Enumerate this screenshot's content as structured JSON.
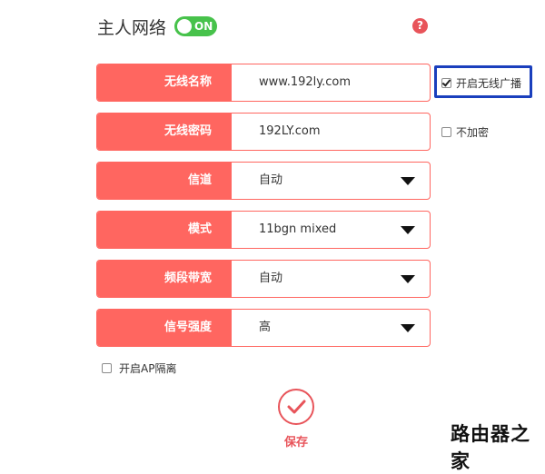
{
  "header": {
    "title": "主人网络",
    "toggle_label": "ON",
    "help_symbol": "?"
  },
  "form": {
    "rows": [
      {
        "label": "无线名称",
        "value": "www.192ly.com"
      },
      {
        "label": "无线密码",
        "value": "192LY.com"
      },
      {
        "label": "信道",
        "value": "自动"
      },
      {
        "label": "模式",
        "value": "11bgn mixed"
      },
      {
        "label": "频段带宽",
        "value": "自动"
      },
      {
        "label": "信号强度",
        "value": "高"
      }
    ],
    "broadcast_checkbox": {
      "label": "开启无线广播",
      "checked": true
    },
    "no_encrypt_checkbox": {
      "label": "不加密",
      "checked": false
    },
    "ap_isolation_checkbox": {
      "label": "开启AP隔离",
      "checked": false
    }
  },
  "footer": {
    "save_label": "保存"
  },
  "watermark": "路由器之家",
  "colors": {
    "accent": "#ff6660",
    "toggle_on": "#47c24b",
    "highlight_border": "#1a3fbd"
  }
}
